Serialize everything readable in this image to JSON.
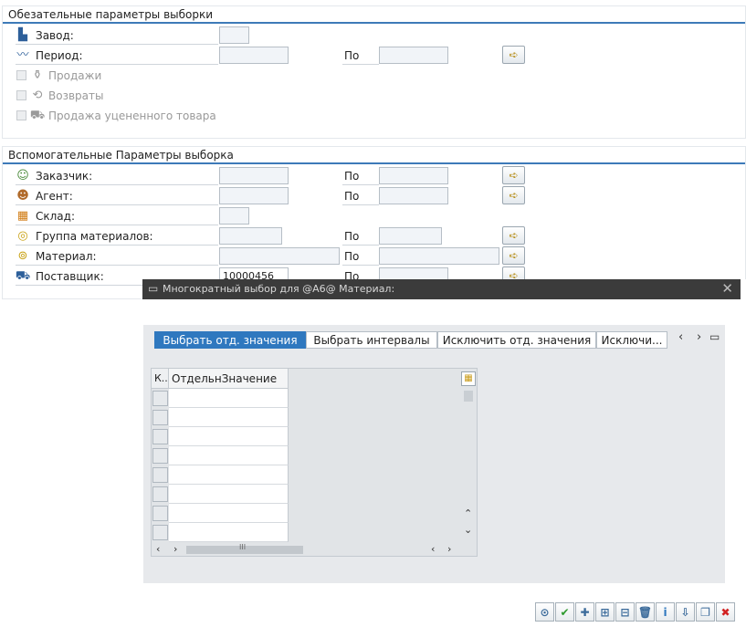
{
  "required": {
    "title": "Обезательные параметры выборки",
    "plant_label": "Завод:",
    "period_label": "Период:",
    "po_label": "По",
    "sales_label": "Продажи",
    "returns_label": "Возвраты",
    "discounted_label": "Продажа уцененного товара"
  },
  "aux": {
    "title": "Вспомогательные Параметры выборка",
    "customer_label": "Заказчик:",
    "agent_label": "Агент:",
    "warehouse_label": "Склад:",
    "matgroup_label": "Группа материалов:",
    "material_label": "Материал:",
    "supplier_label": "Поставщик:",
    "supplier_value": "10000456",
    "po_label": "По"
  },
  "dialog": {
    "title": "Многократный выбор для @A6@ Материал:",
    "tabs": [
      {
        "label": "Выбрать отд. значения",
        "active": true
      },
      {
        "label": "Выбрать интервалы",
        "active": false
      },
      {
        "label": "Исключить отд. значения",
        "active": false
      },
      {
        "label": "Исключи...",
        "active": false
      }
    ],
    "grid_col_k": "К..",
    "grid_col_value": "ОтдельнЗначение",
    "grid_rows": [
      "",
      "",
      "",
      "",
      "",
      "",
      "",
      ""
    ],
    "hscroll_thumb": "III"
  },
  "icons": {
    "plant": "factory-icon",
    "period": "chart-icon",
    "sales": "sales-icon",
    "returns": "returns-icon",
    "discounted": "cart-icon",
    "customer": "person-icon",
    "agent": "agent-icon",
    "warehouse": "grid-icon",
    "matgroup": "material-group-icon",
    "material": "material-icon",
    "supplier": "truck-icon",
    "multi_select": "arrow-right-icon",
    "grid_settings": "table-settings-icon",
    "footer": [
      {
        "icon": "execute-icon",
        "glyph": "⊙"
      },
      {
        "icon": "check-icon",
        "glyph": "✔"
      },
      {
        "icon": "insert-row-icon",
        "glyph": "✚"
      },
      {
        "icon": "add-line-icon",
        "glyph": "⊞"
      },
      {
        "icon": "delete-line-icon",
        "glyph": "⊟"
      },
      {
        "icon": "trash-icon",
        "glyph": "🗑"
      },
      {
        "icon": "info-icon",
        "glyph": "i"
      },
      {
        "icon": "import-icon",
        "glyph": "⇩"
      },
      {
        "icon": "copy-icon",
        "glyph": "❐"
      },
      {
        "icon": "cancel-icon",
        "glyph": "✖"
      }
    ]
  },
  "colors": {
    "accent": "#2f78bf",
    "section_rule": "#3d7ab8",
    "dialog_title_bg": "#3b3b3b",
    "check_green": "#2e9a2e",
    "cancel_red": "#d22222"
  }
}
